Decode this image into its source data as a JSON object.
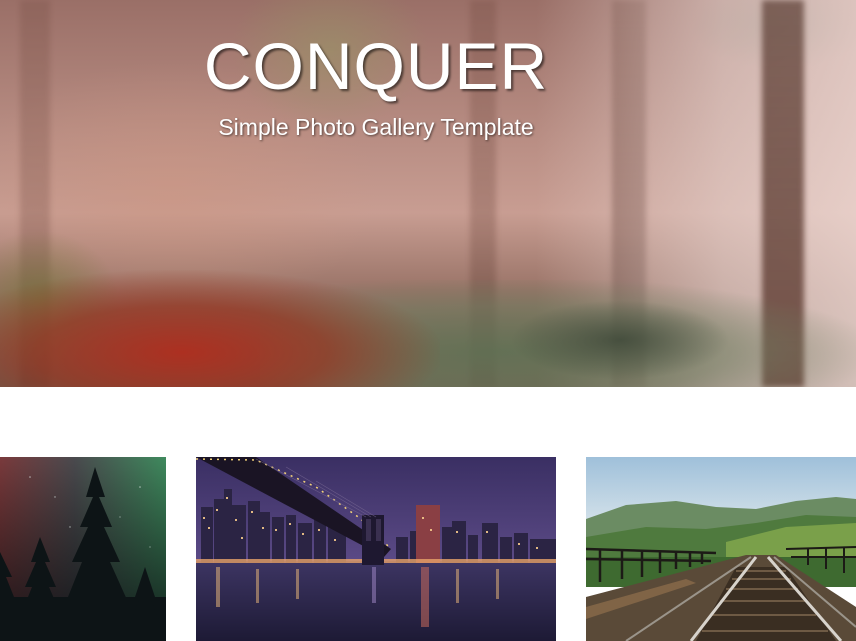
{
  "hero": {
    "title": "CONQUER",
    "subtitle": "Simple Photo Gallery Template"
  },
  "gallery": {
    "items": [
      {
        "subject": "aurora-forest-photo"
      },
      {
        "subject": "city-bridge-night-photo"
      },
      {
        "subject": "railway-bridge-photo"
      }
    ]
  },
  "colors": {
    "hero_title": "#ffffff",
    "page_background": "#ffffff"
  }
}
